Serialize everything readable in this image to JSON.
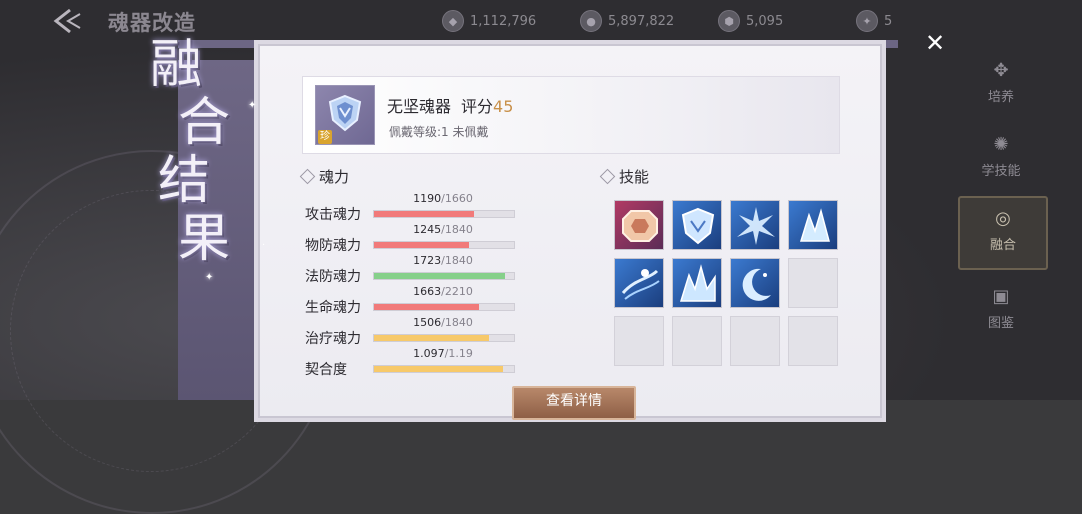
{
  "topbar": {
    "title": "魂器改造",
    "resources": [
      {
        "icon": "crystal-icon",
        "value": "1,112,796"
      },
      {
        "icon": "coin-icon",
        "value": "5,897,822"
      },
      {
        "icon": "shield-gem-icon",
        "value": "5,095"
      },
      {
        "icon": "token-icon",
        "value": "5"
      }
    ]
  },
  "side_menu": [
    {
      "label": "培养",
      "icon": "cultivate-icon"
    },
    {
      "label": "学技能",
      "icon": "learn-skill-icon"
    },
    {
      "label": "融合",
      "icon": "fusion-icon",
      "selected": true
    },
    {
      "label": "图鉴",
      "icon": "gallery-icon"
    }
  ],
  "banner": {
    "chars": [
      "融",
      "合",
      "结",
      "果"
    ]
  },
  "item": {
    "name": "无坚魂器",
    "score_label": "评分",
    "score": "45",
    "rarity_badge": "珍",
    "subtitle": "佩戴等级:1 未佩戴"
  },
  "sections": {
    "stats_title": "魂力",
    "skills_title": "技能"
  },
  "stats": [
    {
      "label": "攻击魂力",
      "value": "1190",
      "max": "/1660",
      "ratio": 0.717,
      "color": "#f17a7a"
    },
    {
      "label": "物防魂力",
      "value": "1245",
      "max": "/1840",
      "ratio": 0.677,
      "color": "#f17a7a"
    },
    {
      "label": "法防魂力",
      "value": "1723",
      "max": "/1840",
      "ratio": 0.936,
      "color": "#86d08a"
    },
    {
      "label": "生命魂力",
      "value": "1663",
      "max": "/2210",
      "ratio": 0.753,
      "color": "#f17a7a"
    },
    {
      "label": "治疗魂力",
      "value": "1506",
      "max": "/1840",
      "ratio": 0.818,
      "color": "#f7c96a"
    },
    {
      "label": "契合度",
      "value": "1.097",
      "max": "/1.19",
      "ratio": 0.922,
      "color": "#f7c96a"
    }
  ],
  "skills": [
    {
      "style": "red",
      "icon": "octagon-gem-skill-icon"
    },
    {
      "style": "blue",
      "icon": "shield-skill-icon"
    },
    {
      "style": "blue",
      "icon": "burst-skill-icon"
    },
    {
      "style": "blue",
      "icon": "ice-shard-skill-icon"
    },
    {
      "style": "blue",
      "icon": "whirlwind-skill-icon"
    },
    {
      "style": "blue",
      "icon": "ice-spike-skill-icon"
    },
    {
      "style": "blue",
      "icon": "moon-skill-icon"
    },
    {
      "style": "empty",
      "icon": ""
    },
    {
      "style": "empty",
      "icon": ""
    },
    {
      "style": "empty",
      "icon": ""
    },
    {
      "style": "empty",
      "icon": ""
    },
    {
      "style": "empty",
      "icon": ""
    }
  ],
  "detail_button": "查看详情"
}
